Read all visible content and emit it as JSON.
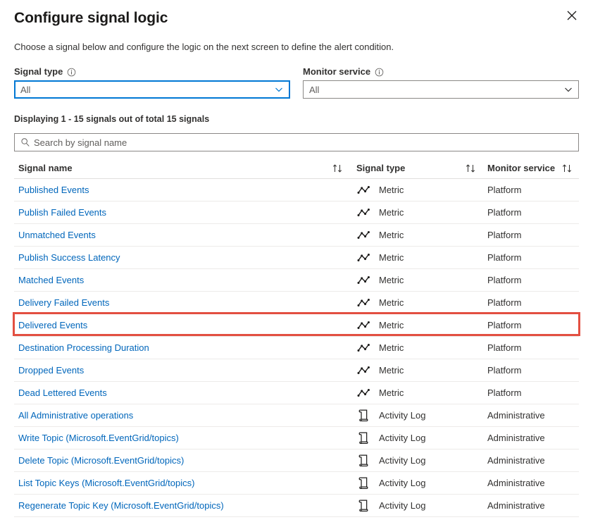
{
  "blade": {
    "title": "Configure signal logic",
    "close_label": "Close",
    "description": "Choose a signal below and configure the logic on the next screen to define the alert condition."
  },
  "filters": {
    "signal_type": {
      "label": "Signal type",
      "info_icon": "info-icon",
      "value": "All"
    },
    "monitor_service": {
      "label": "Monitor service",
      "info_icon": "info-icon",
      "value": "All"
    }
  },
  "results": {
    "count_text": "Displaying 1 - 15 signals out of total 15 signals",
    "search_placeholder": "Search by signal name",
    "search_value": "",
    "search_icon": "search-icon"
  },
  "table": {
    "columns": [
      {
        "key": "signal_name",
        "label": "Signal name",
        "sortable": true
      },
      {
        "key": "signal_type",
        "label": "Signal type",
        "sortable": true
      },
      {
        "key": "monitor_service",
        "label": "Monitor service",
        "sortable": true
      }
    ],
    "sort_icon": "sort-ascending-descending-icon",
    "rows": [
      {
        "signal_name": "Published Events",
        "signal_type": "Metric",
        "monitor_service": "Platform",
        "type_icon": "metric-line-chart-icon",
        "highlighted": false
      },
      {
        "signal_name": "Publish Failed Events",
        "signal_type": "Metric",
        "monitor_service": "Platform",
        "type_icon": "metric-line-chart-icon",
        "highlighted": false
      },
      {
        "signal_name": "Unmatched Events",
        "signal_type": "Metric",
        "monitor_service": "Platform",
        "type_icon": "metric-line-chart-icon",
        "highlighted": false
      },
      {
        "signal_name": "Publish Success Latency",
        "signal_type": "Metric",
        "monitor_service": "Platform",
        "type_icon": "metric-line-chart-icon",
        "highlighted": false
      },
      {
        "signal_name": "Matched Events",
        "signal_type": "Metric",
        "monitor_service": "Platform",
        "type_icon": "metric-line-chart-icon",
        "highlighted": false
      },
      {
        "signal_name": "Delivery Failed Events",
        "signal_type": "Metric",
        "monitor_service": "Platform",
        "type_icon": "metric-line-chart-icon",
        "highlighted": true
      },
      {
        "signal_name": "Delivered Events",
        "signal_type": "Metric",
        "monitor_service": "Platform",
        "type_icon": "metric-line-chart-icon",
        "highlighted": false
      },
      {
        "signal_name": "Destination Processing Duration",
        "signal_type": "Metric",
        "monitor_service": "Platform",
        "type_icon": "metric-line-chart-icon",
        "highlighted": false
      },
      {
        "signal_name": "Dropped Events",
        "signal_type": "Metric",
        "monitor_service": "Platform",
        "type_icon": "metric-line-chart-icon",
        "highlighted": false
      },
      {
        "signal_name": "Dead Lettered Events",
        "signal_type": "Metric",
        "monitor_service": "Platform",
        "type_icon": "metric-line-chart-icon",
        "highlighted": false
      },
      {
        "signal_name": "All Administrative operations",
        "signal_type": "Activity Log",
        "monitor_service": "Administrative",
        "type_icon": "activity-log-scroll-icon",
        "highlighted": false
      },
      {
        "signal_name": "Write Topic (Microsoft.EventGrid/topics)",
        "signal_type": "Activity Log",
        "monitor_service": "Administrative",
        "type_icon": "activity-log-scroll-icon",
        "highlighted": false
      },
      {
        "signal_name": "Delete Topic (Microsoft.EventGrid/topics)",
        "signal_type": "Activity Log",
        "monitor_service": "Administrative",
        "type_icon": "activity-log-scroll-icon",
        "highlighted": false
      },
      {
        "signal_name": "List Topic Keys (Microsoft.EventGrid/topics)",
        "signal_type": "Activity Log",
        "monitor_service": "Administrative",
        "type_icon": "activity-log-scroll-icon",
        "highlighted": false
      },
      {
        "signal_name": "Regenerate Topic Key (Microsoft.EventGrid/topics)",
        "signal_type": "Activity Log",
        "monitor_service": "Administrative",
        "type_icon": "activity-log-scroll-icon",
        "highlighted": false
      }
    ]
  },
  "colors": {
    "link": "#0066bb",
    "accent": "#0078d4",
    "highlight": "#e34f41",
    "text": "#323130",
    "border": "#8a8886",
    "row_divider": "#edebe9"
  }
}
